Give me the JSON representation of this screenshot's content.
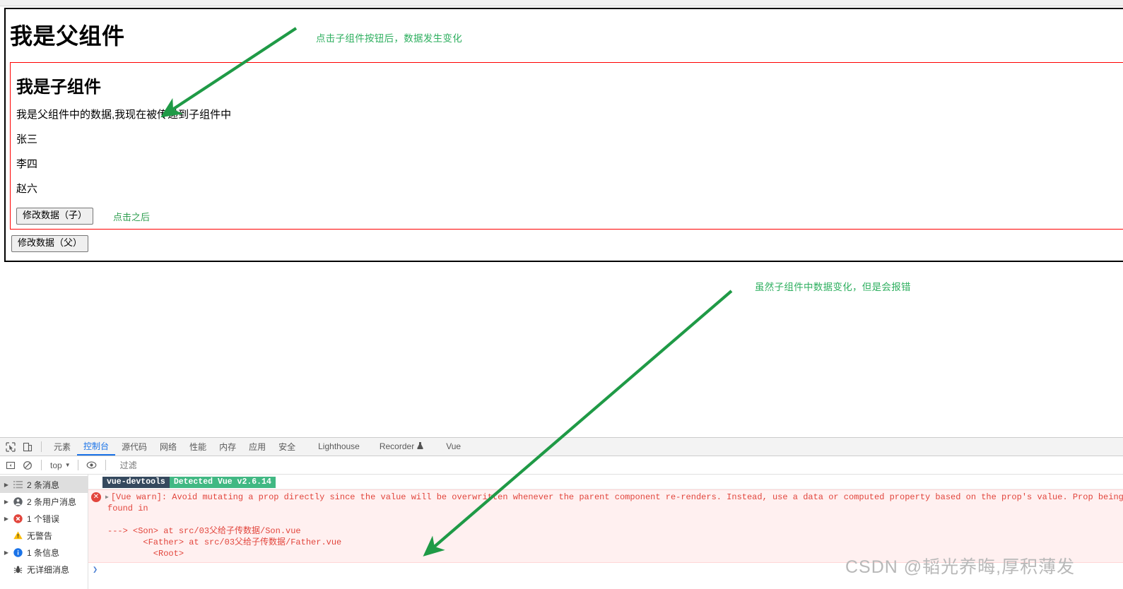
{
  "page": {
    "father_title": "我是父组件",
    "son_title": "我是子组件",
    "son_lines": [
      "我是父组件中的数据,我现在被传递到子组件中",
      "张三",
      "李四",
      "赵六"
    ],
    "son_button": "修改数据（子）",
    "click_after_label": "点击之后",
    "father_button": "修改数据（父）"
  },
  "annotations": {
    "top": "点击子组件按钮后，数据发生变化",
    "bottom": "虽然子组件中数据变化，但是会报错",
    "color": "#2eaf5f"
  },
  "devtools": {
    "tabs": [
      {
        "label": "元素",
        "active": false
      },
      {
        "label": "控制台",
        "active": true
      },
      {
        "label": "源代码",
        "active": false
      },
      {
        "label": "网络",
        "active": false
      },
      {
        "label": "性能",
        "active": false
      },
      {
        "label": "内存",
        "active": false
      },
      {
        "label": "应用",
        "active": false
      },
      {
        "label": "安全",
        "active": false
      },
      {
        "label": "Lighthouse",
        "active": false
      },
      {
        "label": "Recorder",
        "active": false,
        "flask": "⚗"
      },
      {
        "label": "Vue",
        "active": false
      }
    ],
    "icons": {
      "inspect": "inspect-element-icon",
      "device": "device-toolbar-icon",
      "sidebar": "console-sidebar-icon",
      "clear": "clear-console-icon",
      "eye": "live-expression-icon"
    },
    "filterbar": {
      "context": "top",
      "caret": "▼",
      "filter_placeholder": "过滤",
      "filter_value": ""
    },
    "sidebar_items": [
      {
        "label": "2 条消息",
        "icon": "list-icon",
        "arrow": "▶",
        "selected": true
      },
      {
        "label": "2 条用户消息",
        "icon": "user-icon",
        "arrow": "▶",
        "selected": false
      },
      {
        "label": "1 个错误",
        "icon": "error-icon",
        "arrow": "▶",
        "selected": false
      },
      {
        "label": "无警告",
        "icon": "warning-icon",
        "arrow": "",
        "selected": false
      },
      {
        "label": "1 条信息",
        "icon": "info-icon",
        "arrow": "▶",
        "selected": false
      },
      {
        "label": "无详细消息",
        "icon": "verbose-icon",
        "arrow": "",
        "selected": false
      }
    ],
    "messages": {
      "devtools_badge_left": "vue-devtools",
      "devtools_badge_right": "Detected Vue v2.6.14",
      "badge_left_color": "#35495e",
      "badge_right_color": "#41b883",
      "error_caret": "▶",
      "error_text": "[Vue warn]: Avoid mutating a prop directly since the value will be overwritten whenever the parent component re-renders. Instead, use a data or computed property based on the prop's value. Prop being mutated: \"info\"",
      "error_sub_lines": [
        "found in",
        "",
        "---> <Son> at src/03父给子传数据/Son.vue",
        "       <Father> at src/03父给子传数据/Father.vue",
        "         <Root>"
      ],
      "prompt": "❯"
    }
  },
  "watermark": "CSDN @韬光养晦,厚积薄发"
}
